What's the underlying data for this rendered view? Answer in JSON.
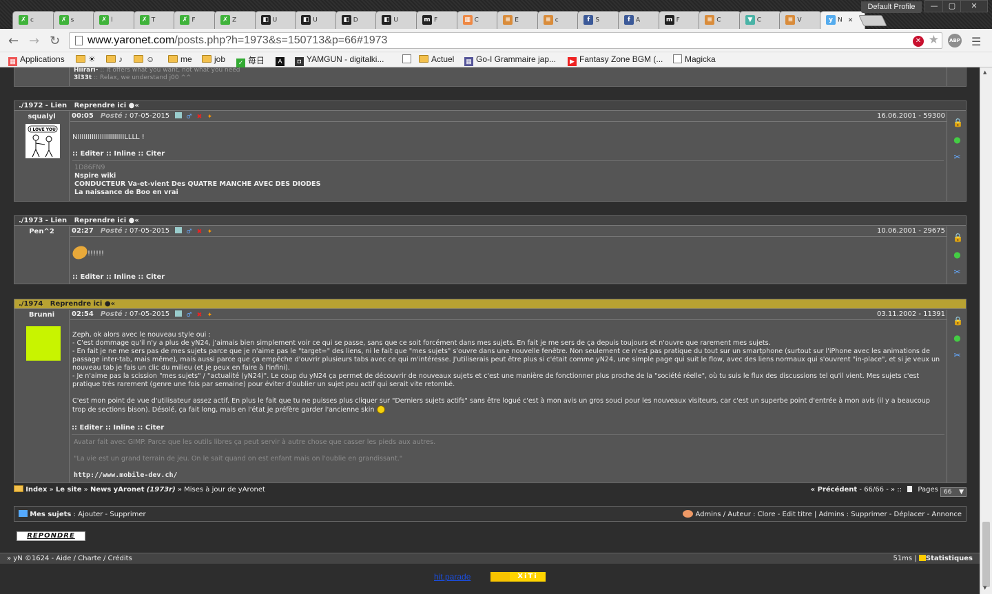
{
  "browser": {
    "profile": "Default Profile",
    "tabs": [
      {
        "label": "c",
        "color": "#3fb33a",
        "glyph": "✗"
      },
      {
        "label": "s",
        "color": "#3fb33a",
        "glyph": "✗"
      },
      {
        "label": "l",
        "color": "#3fb33a",
        "glyph": "✗"
      },
      {
        "label": "T",
        "color": "#3fb33a",
        "glyph": "✗"
      },
      {
        "label": "F",
        "color": "#3fb33a",
        "glyph": "✗"
      },
      {
        "label": "Z",
        "color": "#3fb33a",
        "glyph": "✗"
      },
      {
        "label": "U",
        "color": "#222",
        "glyph": "◧"
      },
      {
        "label": "U",
        "color": "#222",
        "glyph": "◧"
      },
      {
        "label": "D",
        "color": "#222",
        "glyph": "◧"
      },
      {
        "label": "U",
        "color": "#222",
        "glyph": "◧"
      },
      {
        "label": "F",
        "color": "#222",
        "glyph": "m"
      },
      {
        "label": "C",
        "color": "#e84",
        "glyph": "▦"
      },
      {
        "label": "E",
        "color": "#d98c3b",
        "glyph": "≡"
      },
      {
        "label": "c",
        "color": "#d98c3b",
        "glyph": "≡"
      },
      {
        "label": "S",
        "color": "#3b5998",
        "glyph": "f"
      },
      {
        "label": "A",
        "color": "#3b5998",
        "glyph": "f"
      },
      {
        "label": "F",
        "color": "#222",
        "glyph": "m"
      },
      {
        "label": "C",
        "color": "#d98c3b",
        "glyph": "≡"
      },
      {
        "label": "C",
        "color": "#4ab3a6",
        "glyph": "▼"
      },
      {
        "label": "V",
        "color": "#d98c3b",
        "glyph": "≡"
      },
      {
        "label": "N",
        "color": "#55acee",
        "glyph": "y",
        "close": "✕"
      }
    ],
    "url_domain": "www.yaronet.com",
    "url_path": "/posts.php?h=1973&s=150713&p=66#1973",
    "abp": "ABP",
    "bookmarks": [
      {
        "label": "Applications",
        "type": "apps"
      },
      {
        "label": "☀",
        "type": "folder"
      },
      {
        "label": "♪",
        "type": "folder"
      },
      {
        "label": "☺",
        "type": "folder"
      },
      {
        "label": "me",
        "type": "folder"
      },
      {
        "label": "job",
        "type": "folder"
      },
      {
        "label": "毎日",
        "type": "site"
      },
      {
        "label": "",
        "type": "A"
      },
      {
        "label": "YAMGUN - digitalki...",
        "type": "site2"
      },
      {
        "label": "",
        "type": "page"
      },
      {
        "label": "Actuel",
        "type": "folder"
      },
      {
        "label": "Go-I Grammaire jap...",
        "type": "site3"
      },
      {
        "label": "Fantasy Zone BGM (...",
        "type": "yt"
      },
      {
        "label": "Magicka",
        "type": "page"
      }
    ]
  },
  "prev_post": {
    "line1_name": "Hiirari-",
    "line1_text": "It offers what you want, not what you need",
    "line2_name": "3l33t",
    "line2_text": "Relax, we understand j00 ^^"
  },
  "posts": [
    {
      "num": "./1972 - Lien",
      "reprendre": "Reprendre ici ●«",
      "author": "squalyl",
      "time": "00:05",
      "posted_label": "Posté :",
      "date": "07-05-2015",
      "right": "16.06.2001 - 59300",
      "body": "NIIIIIIIIIIIIIIIIIIIIIIILLLL !",
      "actions": ":: Editer :: Inline :: Citer",
      "sig_id": "1D86FN9",
      "sig": [
        "Nspire wiki",
        "CONDUCTEUR Va-et-vient Des QUATRE MANCHE AVEC DES DIODES",
        "La naissance de Boo en vrai"
      ]
    },
    {
      "num": "./1973 - Lien",
      "reprendre": "Reprendre ici ●«",
      "author": "Pen^2",
      "time": "02:27",
      "posted_label": "Posté :",
      "date": "07-05-2015",
      "right": "10.06.2001 - 29675",
      "body": "!!!!!!",
      "actions": ":: Editer :: Inline :: Citer"
    },
    {
      "num": "./1974",
      "reprendre": "Reprendre ici ●«",
      "author": "Brunni",
      "time": "02:54",
      "posted_label": "Posté :",
      "date": "07-05-2015",
      "right": "03.11.2002 - 11391",
      "avatar_color": "#c8f400",
      "body": [
        "Zeph, ok alors avec le nouveau style oui :",
        "- C'est dommage qu'il n'y a plus de yN24, j'aimais bien simplement voir ce qui se passe, sans que ce soit forcément dans mes sujets. En fait je me sers de ça depuis toujours et n'ouvre que rarement mes sujets.",
        "- En fait je ne me sers pas de mes sujets parce que je n'aime pas le \"target=\" des liens, ni le fait que \"mes sujets\" s'ouvre dans une nouvelle fenêtre. Non seulement ce n'est pas pratique du tout sur un smartphone (surtout sur l'iPhone avec les animations de passage inter-tab, mais même), mais aussi parce que ça empêche d'ouvrir plusieurs tabs avec ce qui m'intéresse. J'utiliserais peut être plus si c'était comme yN24, une simple page qui suit le flow, avec des liens normaux qui s'ouvrent \"in-place\", et si je veux un nouveau tab je fais un clic du milieu (et je peux en faire à l'infini).",
        "- Je n'aime pas la scission \"mes sujets\" / \"actualité (yN24)\". Le coup du yN24 ça permet de découvrir de nouveaux sujets et c'est une manière de fonctionner plus proche de la \"société réelle\", où tu suis le flux des discussions tel qu'il vient. Mes sujets c'est pratique très rarement (genre une fois par semaine) pour éviter d'oublier un sujet peu actif qui serait vite retombé.",
        "C'est mon point de vue d'utilisateur assez actif. En plus le fait que tu ne puisses plus cliquer sur \"Derniers sujets actifs\" sans être logué c'est à mon avis un gros souci pour les nouveaux visiteurs, car c'est un superbe point d'entrée à mon avis (il y a beaucoup trop de sections bison). Désolé, ça fait long, mais en l'état je préfère garder l'ancienne skin"
      ],
      "actions": ":: Editer :: Inline :: Citer",
      "sig_lines": [
        "Avatar fait avec GIMP. Parce que les outils libres ça peut servir à autre chose que casser les pieds aux autres.",
        "\"La vie est un grand terrain de jeu. On le sait quand on est enfant mais on l'oublie en grandissant.\""
      ],
      "sig_link": "http://www.mobile-dev.ch/"
    }
  ],
  "breadcrumb": {
    "items": [
      "Index",
      "Le site",
      "News yAronet"
    ],
    "news_suffix": "(1973r)",
    "current": "Mises à jour de yAronet",
    "prev": "« Précédent",
    "pageinfo": "- 66/66 - » ::",
    "pages_label": "Pages",
    "page_value": "66"
  },
  "subjects_bar": {
    "label": "Mes sujets",
    "ajouter": "Ajouter",
    "supprimer": "Supprimer",
    "right": "Admins / Auteur : Clore - Edit titre | Admins : Supprimer - Déplacer - Annonce"
  },
  "reply_button": "REPONDRE",
  "footer": {
    "left": "» yN ©1624 - Aide / Charte / Crédits",
    "timing": "51ms",
    "stats": "Statistiques"
  },
  "hitparade": {
    "left": "hit.parade",
    "right": "XiTi"
  },
  "colors": {
    "accent": "#b8a232",
    "avatar": "#c8f400",
    "link_blue": "#0a3fd6"
  }
}
